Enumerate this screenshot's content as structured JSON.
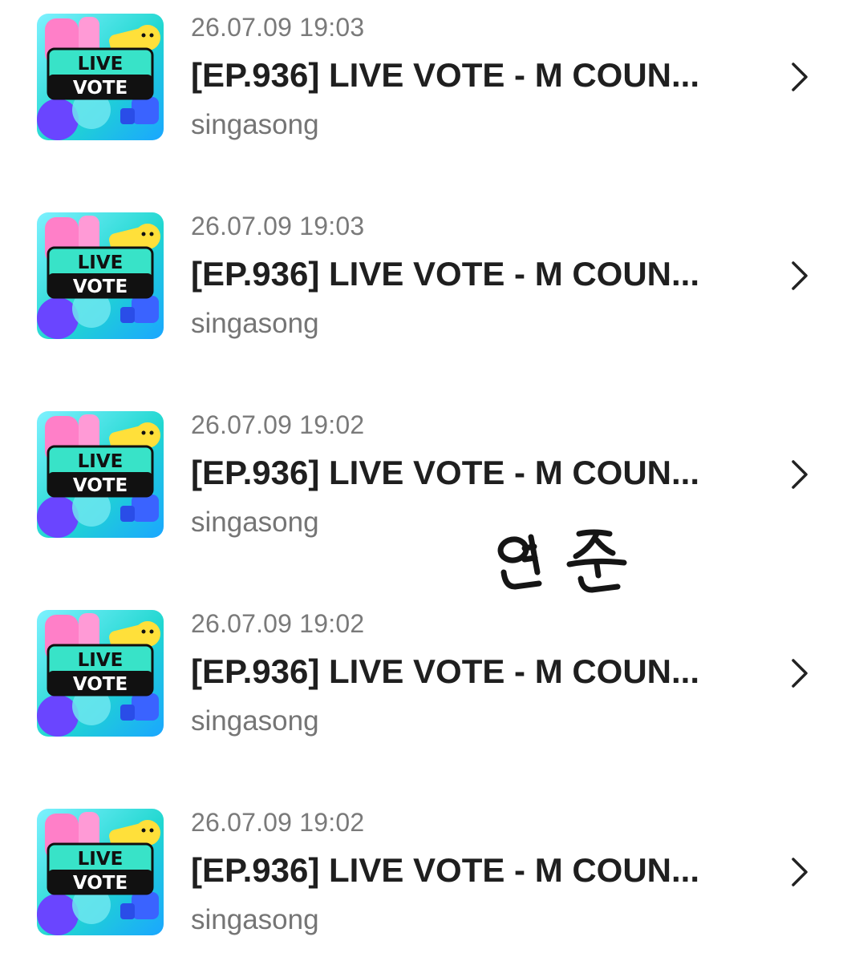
{
  "episodes": [
    {
      "thumbnail_lines": [
        "LIVE",
        "VOTE"
      ],
      "date": "26.07.09 19:03",
      "title": "[EP.936] LIVE VOTE - M COUN...",
      "artist": "singasong",
      "chevron_icon": "chevron-right"
    },
    {
      "thumbnail_lines": [
        "LIVE",
        "VOTE"
      ],
      "date": "26.07.09 19:03",
      "title": "[EP.936] LIVE VOTE - M COUN...",
      "artist": "singasong",
      "chevron_icon": "chevron-right"
    },
    {
      "thumbnail_lines": [
        "LIVE",
        "VOTE"
      ],
      "date": "26.07.09 19:02",
      "title": "[EP.936] LIVE VOTE - M COUN...",
      "artist": "singasong",
      "chevron_icon": "chevron-right"
    },
    {
      "thumbnail_lines": [
        "LIVE",
        "VOTE"
      ],
      "date": "26.07.09 19:02",
      "title": "[EP.936] LIVE VOTE - M COUN...",
      "artist": "singasong",
      "chevron_icon": "chevron-right"
    },
    {
      "thumbnail_lines": [
        "LIVE",
        "VOTE"
      ],
      "date": "26.07.09 19:02",
      "title": "[EP.936] LIVE VOTE - M COUN...",
      "artist": "singasong",
      "chevron_icon": "chevron-right"
    }
  ],
  "signature_text": "연준",
  "colors": {
    "date_text": "#7a7a7a",
    "title_text": "#1f1f1f",
    "artist_text": "#757575",
    "chevron": "#222222",
    "thumb_teal": "#21d7d0",
    "thumb_pink": "#ff7fc8",
    "thumb_yellow": "#ffe03a",
    "thumb_purple": "#6a45ff"
  }
}
